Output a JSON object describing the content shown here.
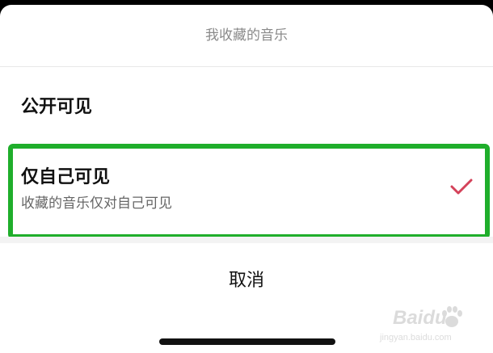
{
  "sheet": {
    "title": "我收藏的音乐"
  },
  "options": [
    {
      "label": "公开可见",
      "selected": false
    },
    {
      "label": "仅自己可见",
      "description": "收藏的音乐仅对自己可见",
      "selected": true
    }
  ],
  "actions": {
    "cancel_label": "取消"
  },
  "colors": {
    "highlight": "#1fae2b",
    "check": "#d4425a"
  },
  "icons": {
    "selected_marker": "checkmark-icon"
  },
  "watermark": {
    "brand": "Baidu",
    "url": "jingyan.baidu.com"
  }
}
